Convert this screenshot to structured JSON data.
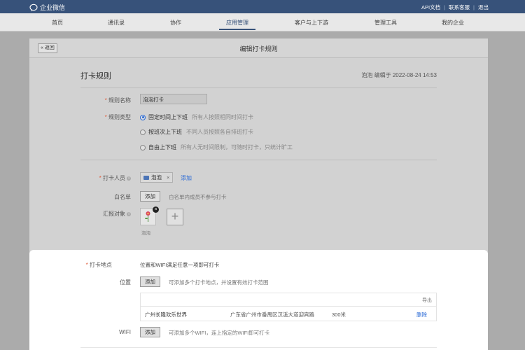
{
  "topbar": {
    "app_name": "企业微信",
    "links": [
      "API文档",
      "联系客服",
      "退出"
    ],
    "separator": "|"
  },
  "nav": {
    "items": [
      "首页",
      "通讯录",
      "协作",
      "应用管理",
      "客户与上下游",
      "管理工具",
      "我的企业"
    ],
    "active": "应用管理"
  },
  "panel": {
    "back_label": "« 返回",
    "title": "编辑打卡规则"
  },
  "rule": {
    "section_title": "打卡规则",
    "meta": "泡泡 编辑于 2022-08-24 14:53",
    "name_label": "规则名称",
    "name_value": "泡泡打卡",
    "type_label": "规则类型",
    "types": [
      {
        "label": "固定时间上下班",
        "desc": "所有人按照相同时间打卡",
        "selected": true
      },
      {
        "label": "按班次上下班",
        "desc": "不同人员按照各自排班打卡",
        "selected": false
      },
      {
        "label": "自由上下班",
        "desc": "所有人无时间限制，可随时打卡，只统计旷工",
        "selected": false
      }
    ],
    "members_label": "打卡人员",
    "member_tag": "泡泡",
    "member_tag_close": "×",
    "add_link": "添加",
    "whitelist_label": "白名单",
    "whitelist_btn": "添加",
    "whitelist_hint": "白名单内成员不参与打卡",
    "report_label": "汇报对象",
    "report_avatar_name": "泡泡",
    "report_close": "×",
    "report_add": "+"
  },
  "location": {
    "label": "打卡地点",
    "desc": "位置和WIFI满足任意一项即可打卡",
    "position_label": "位置",
    "position_btn": "添加",
    "position_hint": "可添加多个打卡地点，并设置有效打卡范围",
    "export": "导出",
    "rows": [
      {
        "name": "广州长隆欢乐世界",
        "address": "广东省广州市番禺区汉溪大道迎宾路",
        "range": "300米",
        "action": "删除"
      }
    ],
    "wifi_label": "WIFI",
    "wifi_btn": "添加",
    "wifi_hint": "可添加多个WIFI，连上指定的WIFI即可打卡"
  },
  "colors": {
    "topbar": "#37527a",
    "accent": "#2a6ad6",
    "required": "#e05a38"
  }
}
